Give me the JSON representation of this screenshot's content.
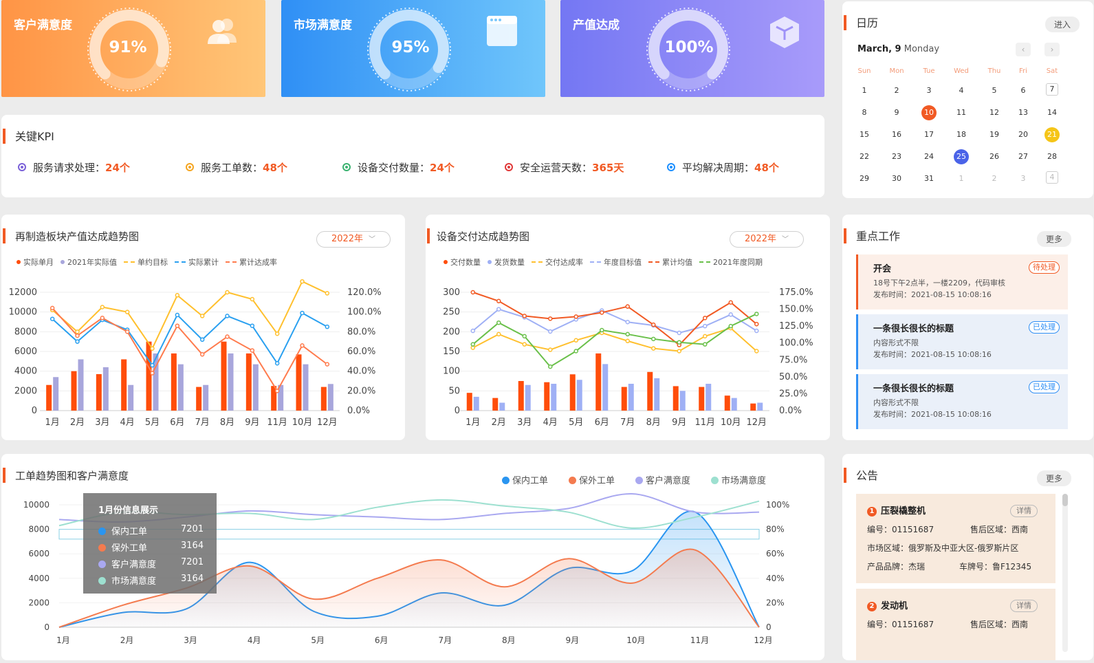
{
  "top_kpis": [
    {
      "label": "客户满意度",
      "value": "91%",
      "fraction": 0.91,
      "icon": "users-icon"
    },
    {
      "label": "市场满意度",
      "value": "95%",
      "fraction": 0.95,
      "icon": "browser-window-icon"
    },
    {
      "label": "产值达成",
      "value": "100%",
      "fraction": 1.0,
      "icon": "cube-icon"
    }
  ],
  "key_kpi": {
    "title": "关键KPI",
    "items": [
      {
        "label": "服务请求处理：",
        "value": "24个",
        "color": "#7b61d8"
      },
      {
        "label": "服务工单数：",
        "value": "48个",
        "color": "#f5a623"
      },
      {
        "label": "设备交付数量：",
        "value": "24个",
        "color": "#3cb371"
      },
      {
        "label": "安全运营天数：",
        "value": "365天",
        "color": "#e03a3a"
      },
      {
        "label": "平均解决周期：",
        "value": "48个",
        "color": "#1e90ff"
      }
    ]
  },
  "calendar": {
    "title": "日历",
    "enter": "进入",
    "date_label": "March, 9",
    "weekday": "Monday",
    "headers": [
      "Sun",
      "Mon",
      "Tue",
      "Wed",
      "Thu",
      "Fri",
      "Sat"
    ],
    "weeks": [
      [
        "1",
        "2",
        "3",
        "4",
        "5",
        "6",
        "7"
      ],
      [
        "8",
        "9",
        "10",
        "11",
        "12",
        "13",
        "14"
      ],
      [
        "15",
        "16",
        "17",
        "18",
        "19",
        "20",
        "21"
      ],
      [
        "22",
        "23",
        "24",
        "25",
        "26",
        "27",
        "28"
      ],
      [
        "29",
        "30",
        "31",
        "1",
        "2",
        "3",
        "4"
      ]
    ]
  },
  "chart1": {
    "title": "再制造板块产值达成趋势图",
    "year": "2022年",
    "legend": [
      "实际单月",
      "2021年实际值",
      "单约目标",
      "实际累计",
      "累计达成率"
    ]
  },
  "chart2": {
    "title": "设备交付达成趋势图",
    "year": "2022年",
    "legend": [
      "交付数量",
      "发货数量",
      "交付达成率",
      "年度目标值",
      "累计均值",
      "2021年度同期"
    ]
  },
  "chart3": {
    "title": "工单趋势图和客户满意度",
    "legend": [
      "保内工单",
      "保外工单",
      "客户满意度",
      "市场满意度"
    ],
    "tooltip": {
      "title": "1月份信息展示",
      "rows": [
        {
          "label": "保内工单",
          "value": "7201"
        },
        {
          "label": "保外工单",
          "value": "3164"
        },
        {
          "label": "客户满意度",
          "value": "7201"
        },
        {
          "label": "市场满意度",
          "value": "3164"
        }
      ]
    }
  },
  "key_work": {
    "title": "重点工作",
    "more": "更多",
    "items": [
      {
        "title": "开会",
        "line1": "18号下午2点半，一楼2209，代码审核",
        "line2": "发布时间：2021-08-15  10:08:16",
        "tag": "待处理"
      },
      {
        "title": "一条很长很长的标题",
        "line1": "内容形式不限",
        "line2": "发布时间：2021-08-15  10:08:16",
        "tag": "已处理"
      },
      {
        "title": "一条很长很长的标题",
        "line1": "内容形式不限",
        "line2": "发布时间：2021-08-15  10:08:16",
        "tag": "已处理"
      }
    ]
  },
  "notices": {
    "title": "公告",
    "more": "更多",
    "items": [
      {
        "num": "1",
        "title": "压裂橇整机",
        "detail": "详情",
        "code": "编号：01151687",
        "region": "售后区域：西南",
        "market": "市场区域：俄罗斯及中亚大区-俄罗斯片区",
        "brand": "产品品牌：杰瑞",
        "plate": "车牌号：鲁F12345"
      },
      {
        "num": "2",
        "title": "发动机",
        "detail": "详情",
        "code": "编号：01151687",
        "region": "售后区域：西南"
      }
    ]
  },
  "chart_data": [
    {
      "type": "bar",
      "title": "再制造板块产值达成趋势图",
      "categories": [
        "1月",
        "2月",
        "3月",
        "4月",
        "5月",
        "6月",
        "7月",
        "8月",
        "9月",
        "11月",
        "10月",
        "12月"
      ],
      "ylim": [
        0,
        12000
      ],
      "y_ticks": [
        "0",
        "2000",
        "4000",
        "6000",
        "8000",
        "10000",
        "12000"
      ],
      "y2lim": [
        0,
        120
      ],
      "y2_ticks": [
        "0.0%",
        "20.0%",
        "40.0%",
        "60.0%",
        "80.0%",
        "100.0%",
        "120.0%"
      ],
      "series": [
        {
          "name": "实际单月",
          "kind": "bar",
          "axis": "left",
          "color": "#ff4d0a",
          "values": [
            2600,
            4000,
            3700,
            5200,
            7000,
            5800,
            2400,
            7000,
            5800,
            2500,
            5700,
            2400
          ]
        },
        {
          "name": "2021年实际值",
          "kind": "bar",
          "axis": "left",
          "color": "#a8a6dc",
          "values": [
            3400,
            5200,
            4400,
            2600,
            5800,
            4700,
            2600,
            5800,
            4700,
            2600,
            4700,
            2700
          ]
        },
        {
          "name": "单约目标",
          "kind": "line",
          "axis": "right",
          "color": "#ffc02e",
          "values": [
            102,
            80,
            105,
            100,
            63,
            117,
            96,
            120,
            113,
            78,
            131,
            119
          ]
        },
        {
          "name": "实际累计",
          "kind": "line",
          "axis": "right",
          "color": "#2aa0f0",
          "values": [
            93,
            70,
            92,
            82,
            46,
            97,
            72,
            96,
            86,
            48,
            99,
            85
          ]
        },
        {
          "name": "累计达成率",
          "kind": "line",
          "axis": "right",
          "color": "#ff7b4d",
          "values": [
            104,
            76,
            94,
            80,
            38,
            86,
            57,
            75,
            61,
            20,
            66,
            47
          ]
        }
      ]
    },
    {
      "type": "bar",
      "title": "设备交付达成趋势图",
      "categories": [
        "1月",
        "2月",
        "3月",
        "4月",
        "5月",
        "6月",
        "7月",
        "8月",
        "9月",
        "11月",
        "10月",
        "12月"
      ],
      "ylim": [
        0,
        300
      ],
      "y_ticks": [
        "0",
        "50",
        "100",
        "150",
        "200",
        "250",
        "300"
      ],
      "y2lim": [
        0,
        175
      ],
      "y2_ticks": [
        "0.0%",
        "25.0%",
        "50.0%",
        "75.0%",
        "100.0%",
        "125.0%",
        "150.0%",
        "175.0%"
      ],
      "series": [
        {
          "name": "交付数量",
          "kind": "bar",
          "axis": "left",
          "color": "#ff4d0a",
          "values": [
            45,
            32,
            75,
            72,
            92,
            145,
            60,
            98,
            62,
            60,
            38,
            18
          ]
        },
        {
          "name": "发货数量",
          "kind": "bar",
          "axis": "left",
          "color": "#9fb0f5",
          "values": [
            35,
            20,
            65,
            68,
            78,
            118,
            68,
            82,
            50,
            68,
            32,
            20
          ]
        },
        {
          "name": "交付达成率",
          "kind": "line",
          "axis": "right",
          "color": "#ffc02e",
          "values": [
            93,
            113,
            98,
            90,
            104,
            115,
            103,
            92,
            88,
            110,
            122,
            88
          ]
        },
        {
          "name": "年度目标值",
          "kind": "line",
          "axis": "right",
          "color": "#9fb0f5",
          "values": [
            118,
            150,
            138,
            117,
            135,
            148,
            131,
            126,
            115,
            125,
            142,
            118
          ]
        },
        {
          "name": "累计均值",
          "kind": "line",
          "axis": "right",
          "color": "#f15a24",
          "values": [
            175,
            162,
            140,
            136,
            139,
            145,
            154,
            127,
            97,
            137,
            160,
            128
          ]
        },
        {
          "name": "2021年度同期",
          "kind": "line",
          "axis": "right",
          "color": "#6ac04a",
          "values": [
            98,
            130,
            110,
            65,
            88,
            119,
            113,
            106,
            101,
            98,
            125,
            143
          ]
        }
      ]
    },
    {
      "type": "area",
      "title": "工单趋势图和客户满意度",
      "categories": [
        "1月",
        "2月",
        "3月",
        "4月",
        "5月",
        "6月",
        "7月",
        "8月",
        "9月",
        "10月",
        "11月",
        "12月"
      ],
      "ylim": [
        0,
        10000
      ],
      "y_ticks": [
        "0",
        "2000",
        "4000",
        "6000",
        "8000",
        "10000"
      ],
      "y2lim": [
        0,
        100
      ],
      "y2_ticks": [
        "0",
        "20%",
        "40%",
        "60%",
        "80%",
        "100%"
      ],
      "series": [
        {
          "name": "保内工单",
          "axis": "left",
          "color": "#2a95f0",
          "values": [
            0,
            1200,
            1500,
            5300,
            1300,
            900,
            2800,
            1800,
            4800,
            4600,
            9400,
            0
          ]
        },
        {
          "name": "保外工单",
          "axis": "left",
          "color": "#f47b4f",
          "values": [
            0,
            1800,
            3200,
            5000,
            2300,
            4000,
            5500,
            3300,
            5600,
            3600,
            6300,
            0
          ]
        },
        {
          "name": "客户满意度",
          "axis": "right",
          "color": "#a9a8f0",
          "values": [
            88,
            86,
            90,
            95,
            92,
            90,
            88,
            93,
            97,
            109,
            94,
            94
          ]
        },
        {
          "name": "市场满意度",
          "axis": "right",
          "color": "#9de0d0",
          "values": [
            83,
            94,
            92,
            93,
            88,
            98,
            104,
            99,
            94,
            81,
            90,
            103
          ]
        }
      ]
    }
  ]
}
